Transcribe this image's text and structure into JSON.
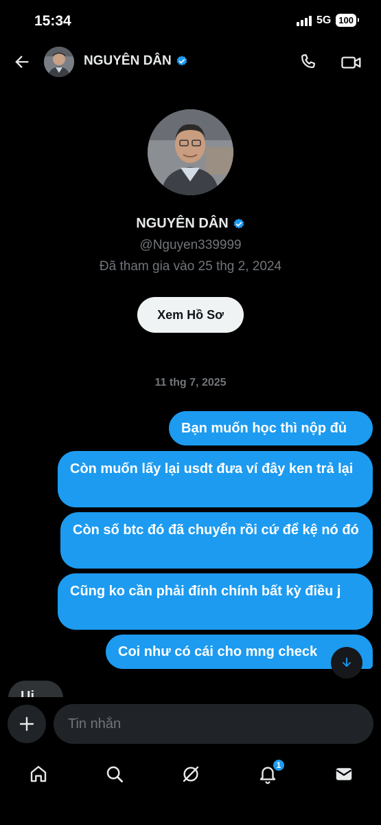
{
  "status_bar": {
    "time": "15:34",
    "network": "5G",
    "battery": "100"
  },
  "header": {
    "name": "NGUYÊN DÂN",
    "verified": true
  },
  "profile": {
    "name": "NGUYÊN DÂN",
    "handle": "@Nguyen339999",
    "joined": "Đã tham gia vào 25 thg 2, 2024",
    "view_profile_label": "Xem Hồ Sơ"
  },
  "date_separator": "11 thg 7, 2025",
  "messages": [
    {
      "direction": "outgoing",
      "text": "Bạn muốn học thì nộp đủ"
    },
    {
      "direction": "outgoing",
      "text": "Còn muốn lấy lại usdt đưa ví đây ken trả lại"
    },
    {
      "direction": "outgoing",
      "text": "Còn số btc đó đã chuyển rồi cứ để kệ nó đó"
    },
    {
      "direction": "outgoing",
      "text": "Cũng ko cần phải đính chính bất kỳ điều j"
    },
    {
      "direction": "outgoing",
      "text": "Coi như có cái cho mng check"
    }
  ],
  "incoming_partial": "Ui",
  "composer": {
    "placeholder": "Tin nhắn"
  },
  "bottom_nav": {
    "items": [
      "home-icon",
      "search-icon",
      "grok-icon",
      "notifications-icon",
      "messages-icon"
    ],
    "notifications_badge": "1"
  },
  "colors": {
    "accent": "#1d9bf0",
    "background": "#000000",
    "muted": "#71767b"
  }
}
